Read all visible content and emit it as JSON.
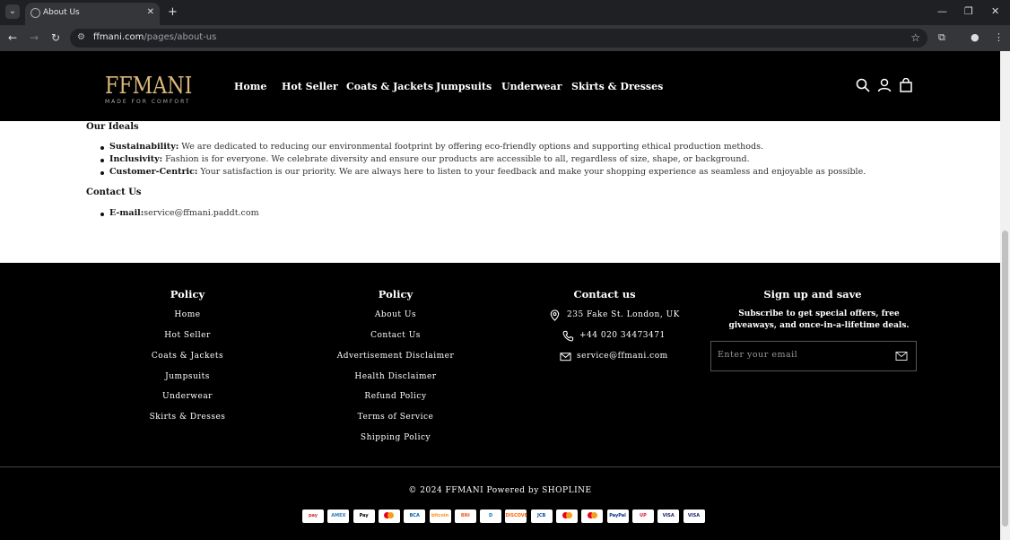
{
  "browser": {
    "tab_title": "About Us",
    "url_host": "ffmani.com",
    "url_path": "/pages/about-us"
  },
  "header": {
    "logo_text": "FFMANI",
    "logo_tagline": "MADE FOR COMFORT",
    "nav": [
      "Home",
      "Hot Seller",
      "Coats & Jackets",
      "Jumpsuits",
      "Underwear",
      "Skirts & Dresses"
    ]
  },
  "content": {
    "ideals_heading": "Our Ideals",
    "ideals": [
      {
        "title": "Sustainability:",
        "text": " We are dedicated to reducing our environmental footprint by offering eco-friendly options and supporting ethical production methods."
      },
      {
        "title": "Inclusivity:",
        "text": " Fashion is for everyone. We celebrate diversity and ensure our products are accessible to all, regardless of size, shape, or background."
      },
      {
        "title": "Customer-Centric:",
        "text": " Your satisfaction is our priority. We are always here to listen to your feedback and make your shopping experience as seamless and enjoyable as possible."
      }
    ],
    "contact_heading": "Contact Us",
    "email_label": "E-mail:",
    "email_value": "service@ffmani.paddt.com"
  },
  "footer": {
    "col1": {
      "heading": "Policy",
      "links": [
        "Home",
        "Hot Seller",
        "Coats & Jackets",
        "Jumpsuits",
        "Underwear",
        "Skirts & Dresses"
      ]
    },
    "col2": {
      "heading": "Policy",
      "links": [
        "About Us",
        "Contact Us",
        "Advertisement Disclaimer",
        "Health Disclaimer",
        "Refund Policy",
        "Terms of Service",
        "Shipping Policy"
      ]
    },
    "col3": {
      "heading": "Contact us",
      "address": "235 Fake St. London, UK",
      "phone": "+44 020 34473471",
      "email": "service@ffmani.com"
    },
    "col4": {
      "heading": "Sign up and save",
      "text": "Subscribe to get special offers, free giveaways, and once-in-a-lifetime deals.",
      "email_placeholder": "Enter your email"
    },
    "copyright": "© 2024 FFMANI  Powered by SHOPLINE",
    "payment_icons": [
      {
        "name": "pay-1-icon",
        "label": "pay",
        "color": "#d32f2f"
      },
      {
        "name": "amex-icon",
        "label": "AMEX",
        "color": "#2e77bc"
      },
      {
        "name": "apple-pay-icon",
        "label": "Pay",
        "color": "#000000"
      },
      {
        "name": "pay-4-icon",
        "label": "",
        "color": "#1a1a1a"
      },
      {
        "name": "bca-icon",
        "label": "BCA",
        "color": "#0060af"
      },
      {
        "name": "bitcoin-icon",
        "label": "bitcoin",
        "color": "#f7931a"
      },
      {
        "name": "bni-icon",
        "label": "BNI",
        "color": "#f15a23"
      },
      {
        "name": "diners-icon",
        "label": "D",
        "color": "#0079be"
      },
      {
        "name": "discover-icon",
        "label": "DISCOVER",
        "color": "#ff6000"
      },
      {
        "name": "jcb-icon",
        "label": "JCB",
        "color": "#0b4ea2"
      },
      {
        "name": "maestro-icon",
        "label": "",
        "color": "#eb001b"
      },
      {
        "name": "mastercard-icon",
        "label": "",
        "color": "#f79e1b"
      },
      {
        "name": "paypal-icon",
        "label": "PayPal",
        "color": "#003087"
      },
      {
        "name": "unionpay-icon",
        "label": "UP",
        "color": "#e21836"
      },
      {
        "name": "visa-icon",
        "label": "VISA",
        "color": "#1a1f71"
      },
      {
        "name": "visa-2-icon",
        "label": "VISA",
        "color": "#1a1f71"
      }
    ]
  }
}
